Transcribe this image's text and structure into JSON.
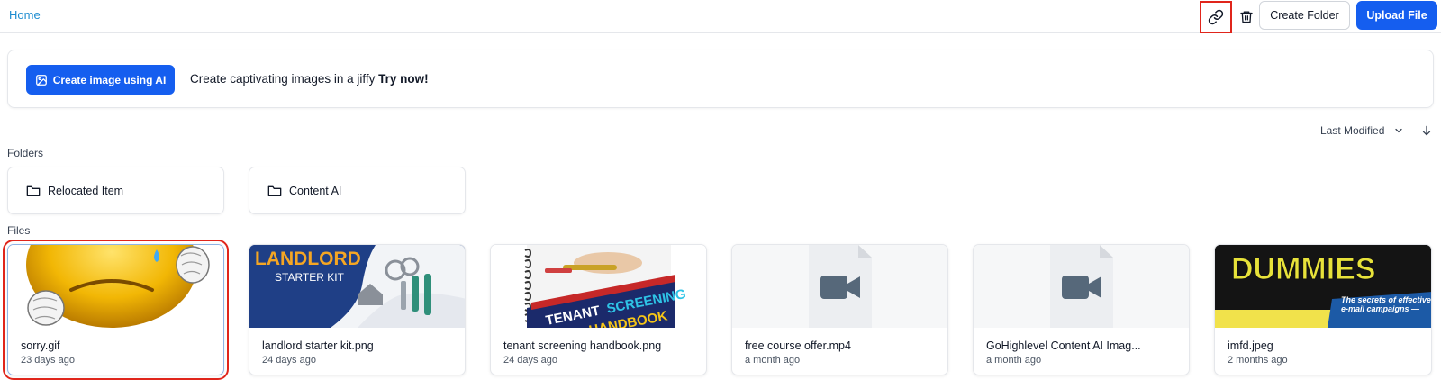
{
  "header": {
    "home_label": "Home",
    "create_folder_label": "Create Folder",
    "upload_label": "Upload File"
  },
  "banner": {
    "button_label": "Create image using AI",
    "text": "Create captivating images in a jiffy",
    "cta": "Try now!"
  },
  "sort": {
    "label": "Last Modified"
  },
  "folders": {
    "label": "Folders",
    "items": [
      {
        "name": "Relocated Item"
      },
      {
        "name": "Content AI"
      }
    ]
  },
  "files": {
    "label": "Files",
    "items": [
      {
        "name": "sorry.gif",
        "time": "23 days ago",
        "thumb": "emoji"
      },
      {
        "name": "landlord starter kit.png",
        "time": "24 days ago",
        "thumb": "landlord",
        "thumb_title": "LANDLORD",
        "thumb_sub": "STARTER KIT"
      },
      {
        "name": "tenant screening handbook.png",
        "time": "24 days ago",
        "thumb": "tenant",
        "thumb_title": "TENANT",
        "thumb_title2": "SCREENING",
        "thumb_sub": "HANDBOOK"
      },
      {
        "name": "free course offer.mp4",
        "time": "a month ago",
        "thumb": "video"
      },
      {
        "name": "GoHighlevel Content AI Imag...",
        "time": "a month ago",
        "thumb": "video"
      },
      {
        "name": "imfd.jpeg",
        "time": "2 months ago",
        "thumb": "dummies",
        "thumb_title": "DUMMIES",
        "thumb_sub": "The secrets of effective e-mail campaigns —"
      }
    ]
  },
  "colors": {
    "primary": "#155eef",
    "link": "#1c8cd0",
    "highlight": "#e0251b"
  }
}
